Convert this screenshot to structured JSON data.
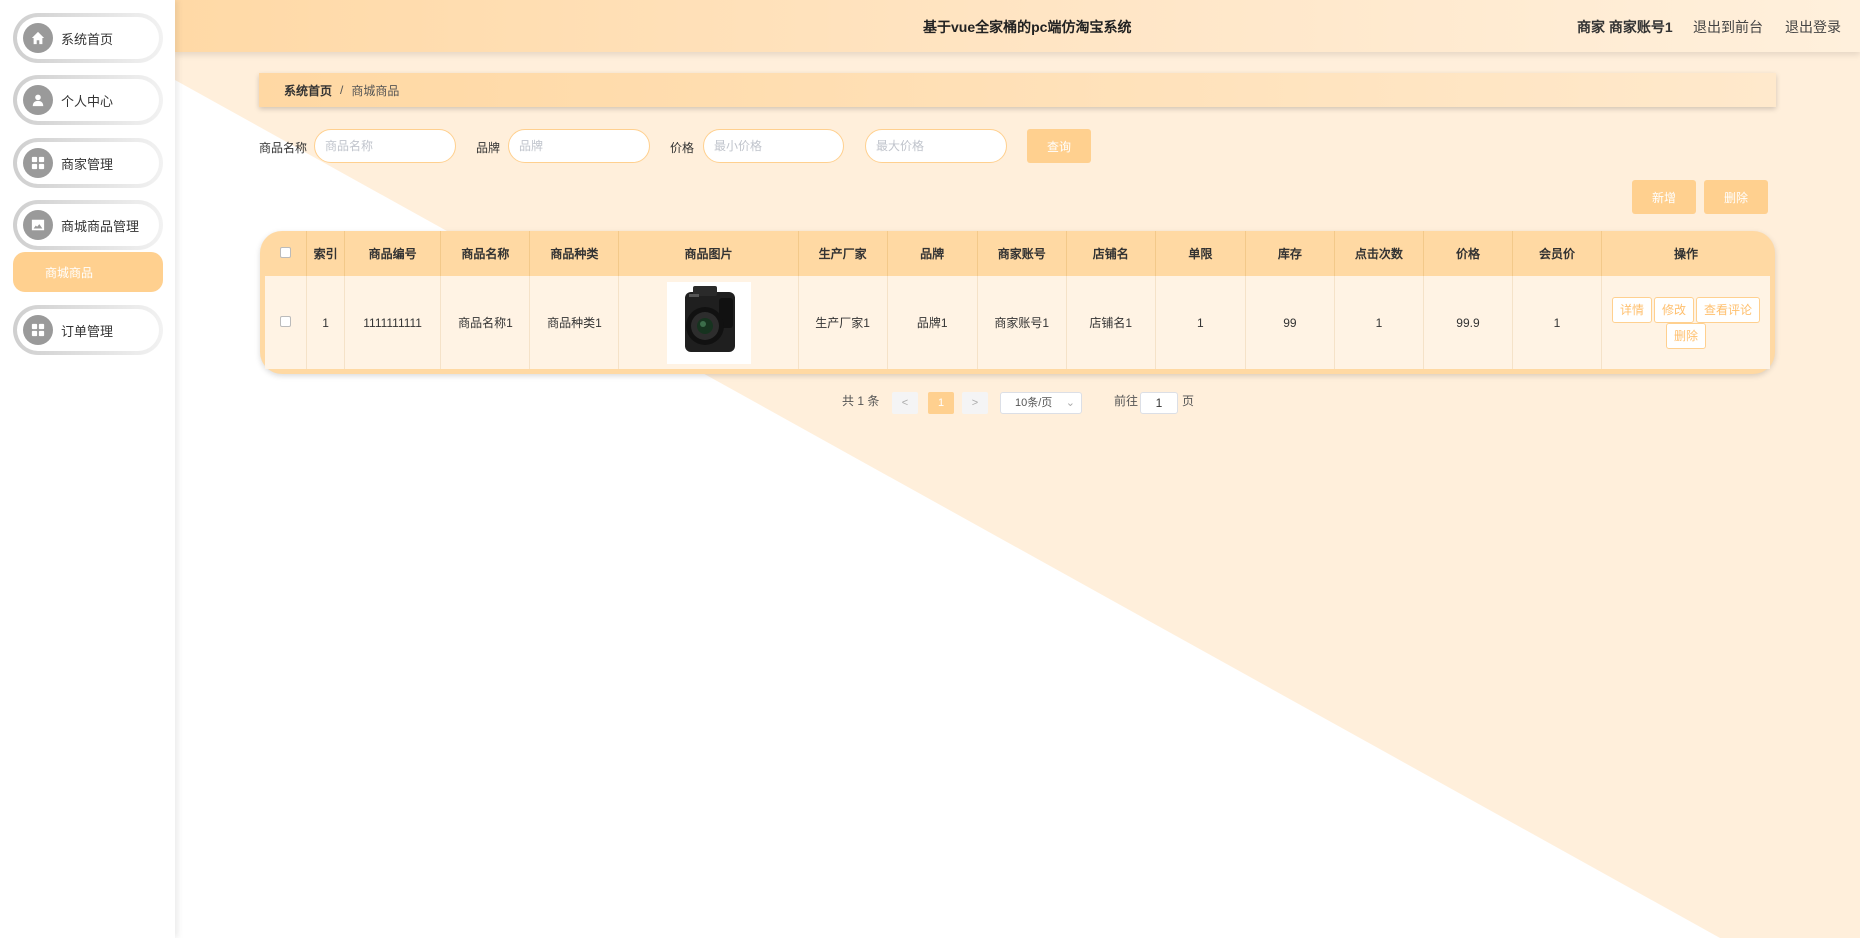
{
  "app": {
    "title": "基于vue全家桶的pc端仿淘宝系统",
    "user_label": "商家 商家账号1",
    "to_front_label": "退出到前台",
    "logout_label": "退出登录"
  },
  "sidebar": {
    "items": [
      {
        "label": "系统首页",
        "icon": "home-icon"
      },
      {
        "label": "个人中心",
        "icon": "user-icon"
      },
      {
        "label": "商家管理",
        "icon": "grid-icon"
      },
      {
        "label": "商城商品管理",
        "icon": "image-icon"
      },
      {
        "label": "订单管理",
        "icon": "grid-icon"
      }
    ],
    "sub_item": "商城商品"
  },
  "breadcrumb": {
    "home": "系统首页",
    "separator": "/",
    "current": "商城商品"
  },
  "search": {
    "name_label": "商品名称",
    "name_placeholder": "商品名称",
    "brand_label": "品牌",
    "brand_placeholder": "品牌",
    "price_label": "价格",
    "min_placeholder": "最小价格",
    "max_placeholder": "最大价格",
    "query_label": "查询"
  },
  "actions": {
    "add_label": "新增",
    "delete_label": "删除"
  },
  "table": {
    "headers": [
      "索引",
      "商品编号",
      "商品名称",
      "商品种类",
      "商品图片",
      "生产厂家",
      "品牌",
      "商家账号",
      "店铺名",
      "单限",
      "库存",
      "点击次数",
      "价格",
      "会员价",
      "操作"
    ],
    "rows": [
      {
        "index": "1",
        "code": "1111111111",
        "name": "商品名称1",
        "category": "商品种类1",
        "manufacturer": "生产厂家1",
        "brand": "品牌1",
        "merchant": "商家账号1",
        "shop": "店铺名1",
        "limit": "1",
        "stock": "99",
        "clicks": "1",
        "price": "99.9",
        "member_price": "1",
        "ops": [
          "详情",
          "修改",
          "查看评论",
          "删除"
        ]
      }
    ]
  },
  "pagination": {
    "total": "共 1 条",
    "prev": "<",
    "current": "1",
    "next": ">",
    "page_size": "10条/页",
    "goto": "前往",
    "goto_value": "1",
    "page_suffix": "页"
  },
  "colors": {
    "accent": "#ffd08f",
    "background_triangle": "#ffefdb"
  }
}
